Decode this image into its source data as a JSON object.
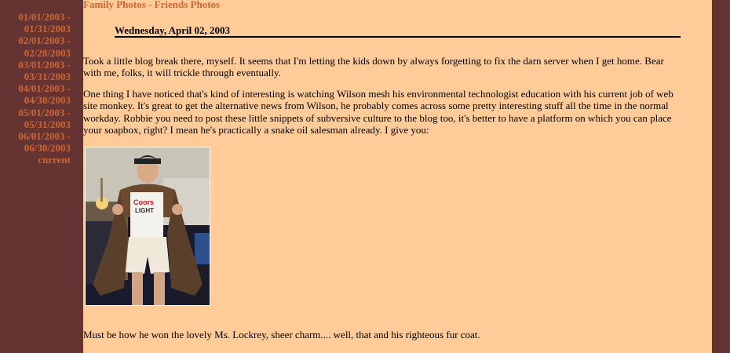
{
  "sidebar": {
    "archive": [
      {
        "label": "01/01/2003 -",
        "label2": "01/31/2003"
      },
      {
        "label": "02/01/2003 -",
        "label2": "02/28/2003"
      },
      {
        "label": "03/01/2003 -",
        "label2": "03/31/2003"
      },
      {
        "label": "04/01/2003 -",
        "label2": "04/30/2003"
      },
      {
        "label": "05/01/2003 -",
        "label2": "05/31/2003"
      },
      {
        "label": "06/01/2003 -",
        "label2": "06/30/2003"
      }
    ],
    "current_label": "current"
  },
  "topnav": {
    "family_photos": "Family Photos",
    "separator": " - ",
    "friends_photos": "Friends Photos"
  },
  "post": {
    "date": "Wednesday, April 02, 2003",
    "paragraph1": "Took a little blog break there, myself. It seems that I'm letting the kids down by always forgetting to fix the darn server when I get home. Bear with me, folks, it will trickle through eventually.",
    "paragraph2": "One thing I have noticed that's kind of interesting is watching Wilson mesh his environmental technologist education with his current job of web site monkey. It's great to get the alternative news from Wilson, he probably comes across some pretty interesting stuff all the time in the normal workday. Robbie you need to post these little snippets of subversive culture to the blog too, it's better to have a platform on which you can place your soapbox, right? I mean he's practically a snake oil salesman already. I give you:",
    "paragraph3": "Must be how he won the lovely Ms. Lockrey, sheer charm.... well, that and his righteous fur coat."
  },
  "colors": {
    "background": "#663333",
    "content_bg": "#ffcc99",
    "link": "#cc6633",
    "text": "#000000"
  }
}
